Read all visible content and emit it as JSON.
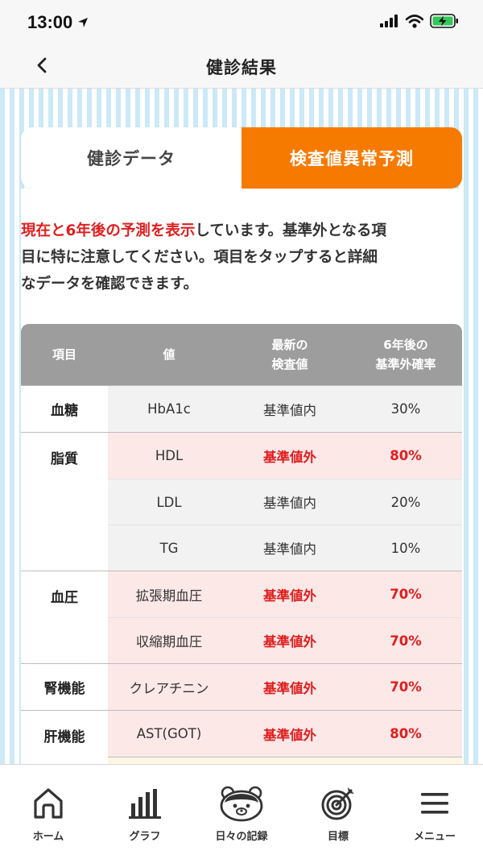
{
  "status": {
    "time": "13:00"
  },
  "nav": {
    "title": "健診結果"
  },
  "tabs": [
    {
      "label": "健診データ",
      "active": false
    },
    {
      "label": "検査値異常予測",
      "active": true
    }
  ],
  "description": {
    "highlight": "現在と6年後の予測を表示",
    "line1_rest": "しています。基準外となる項",
    "line2": "目に特に注意してください。項目をタップすると詳細",
    "line3": "なデータを確認できます。"
  },
  "table": {
    "headers": {
      "category": "項目",
      "item": "値",
      "latest_line1": "最新の",
      "latest_line2": "検査値",
      "future_line1": "6年後の",
      "future_line2": "基準外確率"
    },
    "groups": [
      {
        "category": "血糖",
        "rows": [
          {
            "item": "HbA1c",
            "value": "基準値内",
            "probability": "30%",
            "abnormal": false
          }
        ]
      },
      {
        "category": "脂質",
        "rows": [
          {
            "item": "HDL",
            "value": "基準値外",
            "probability": "80%",
            "abnormal": true
          },
          {
            "item": "LDL",
            "value": "基準値内",
            "probability": "20%",
            "abnormal": false
          },
          {
            "item": "TG",
            "value": "基準値内",
            "probability": "10%",
            "abnormal": false
          }
        ]
      },
      {
        "category": "血圧",
        "rows": [
          {
            "item": "拡張期血圧",
            "value": "基準値外",
            "probability": "70%",
            "abnormal": true
          },
          {
            "item": "収縮期血圧",
            "value": "基準値外",
            "probability": "70%",
            "abnormal": true
          }
        ]
      },
      {
        "category": "腎機能",
        "rows": [
          {
            "item": "クレアチニン",
            "value": "基準値外",
            "probability": "70%",
            "abnormal": true
          }
        ]
      },
      {
        "category": "肝機能",
        "rows": [
          {
            "item": "AST(GOT)",
            "value": "基準値外",
            "probability": "80%",
            "abnormal": true
          }
        ]
      }
    ]
  },
  "bottom_nav": [
    {
      "label": "ホーム",
      "icon": "home-icon"
    },
    {
      "label": "グラフ",
      "icon": "bar-chart-icon"
    },
    {
      "label": "日々の記録",
      "icon": "bear-face-icon"
    },
    {
      "label": "目標",
      "icon": "target-icon"
    },
    {
      "label": "メニュー",
      "icon": "menu-icon"
    }
  ],
  "colors": {
    "accent": "#f77a00",
    "alert": "#e01e1e",
    "stripe": "#cbe9f6",
    "header_gray": "#9d9d9d",
    "abnormal_bg": "#fde8e8"
  }
}
